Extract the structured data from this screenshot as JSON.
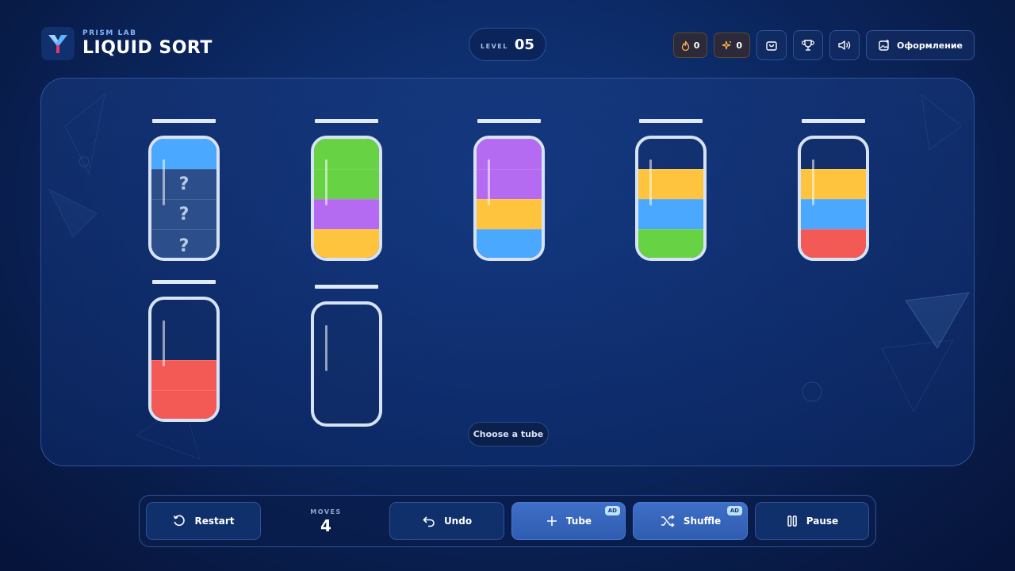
{
  "brand": {
    "subtitle": "PRISM LAB",
    "title": "LIQUID SORT",
    "logo": "y-prism-logo"
  },
  "level": {
    "label": "LEVEL",
    "value": "05"
  },
  "counters": [
    {
      "icon": "flame-icon",
      "value": "0"
    },
    {
      "icon": "sparkle-icon",
      "value": "0"
    }
  ],
  "toolbar": {
    "shop_icon": "bag-icon",
    "trophy_icon": "trophy-icon",
    "sound_icon": "speaker-icon",
    "theme_label": "Оформление"
  },
  "colors": {
    "blue": "#4aa8ff",
    "green": "#66d244",
    "purple": "#b46bf2",
    "yellow": "#ffc43d",
    "red": "#f45a55",
    "hidden": "#2c4f8c"
  },
  "tubes": [
    {
      "layers": [
        "blue",
        "hidden",
        "hidden",
        "hidden"
      ]
    },
    {
      "layers": [
        "green",
        "green",
        "purple",
        "yellow"
      ]
    },
    {
      "layers": [
        "purple",
        "purple",
        "yellow",
        "blue"
      ]
    },
    {
      "layers": [
        "empty",
        "yellow",
        "blue",
        "green"
      ]
    },
    {
      "layers": [
        "empty",
        "yellow",
        "blue",
        "red"
      ]
    },
    {
      "layers": [
        "empty",
        "empty",
        "red",
        "red"
      ]
    },
    {
      "layers": [
        "empty",
        "empty",
        "empty",
        "empty"
      ]
    }
  ],
  "hidden_mark": "?",
  "hint": "Choose a tube",
  "moves": {
    "label": "MOVES",
    "value": "4"
  },
  "buttons": {
    "restart": "Restart",
    "undo": "Undo",
    "tube": "Tube",
    "shuffle": "Shuffle",
    "pause": "Pause",
    "ad_badge": "AD"
  }
}
